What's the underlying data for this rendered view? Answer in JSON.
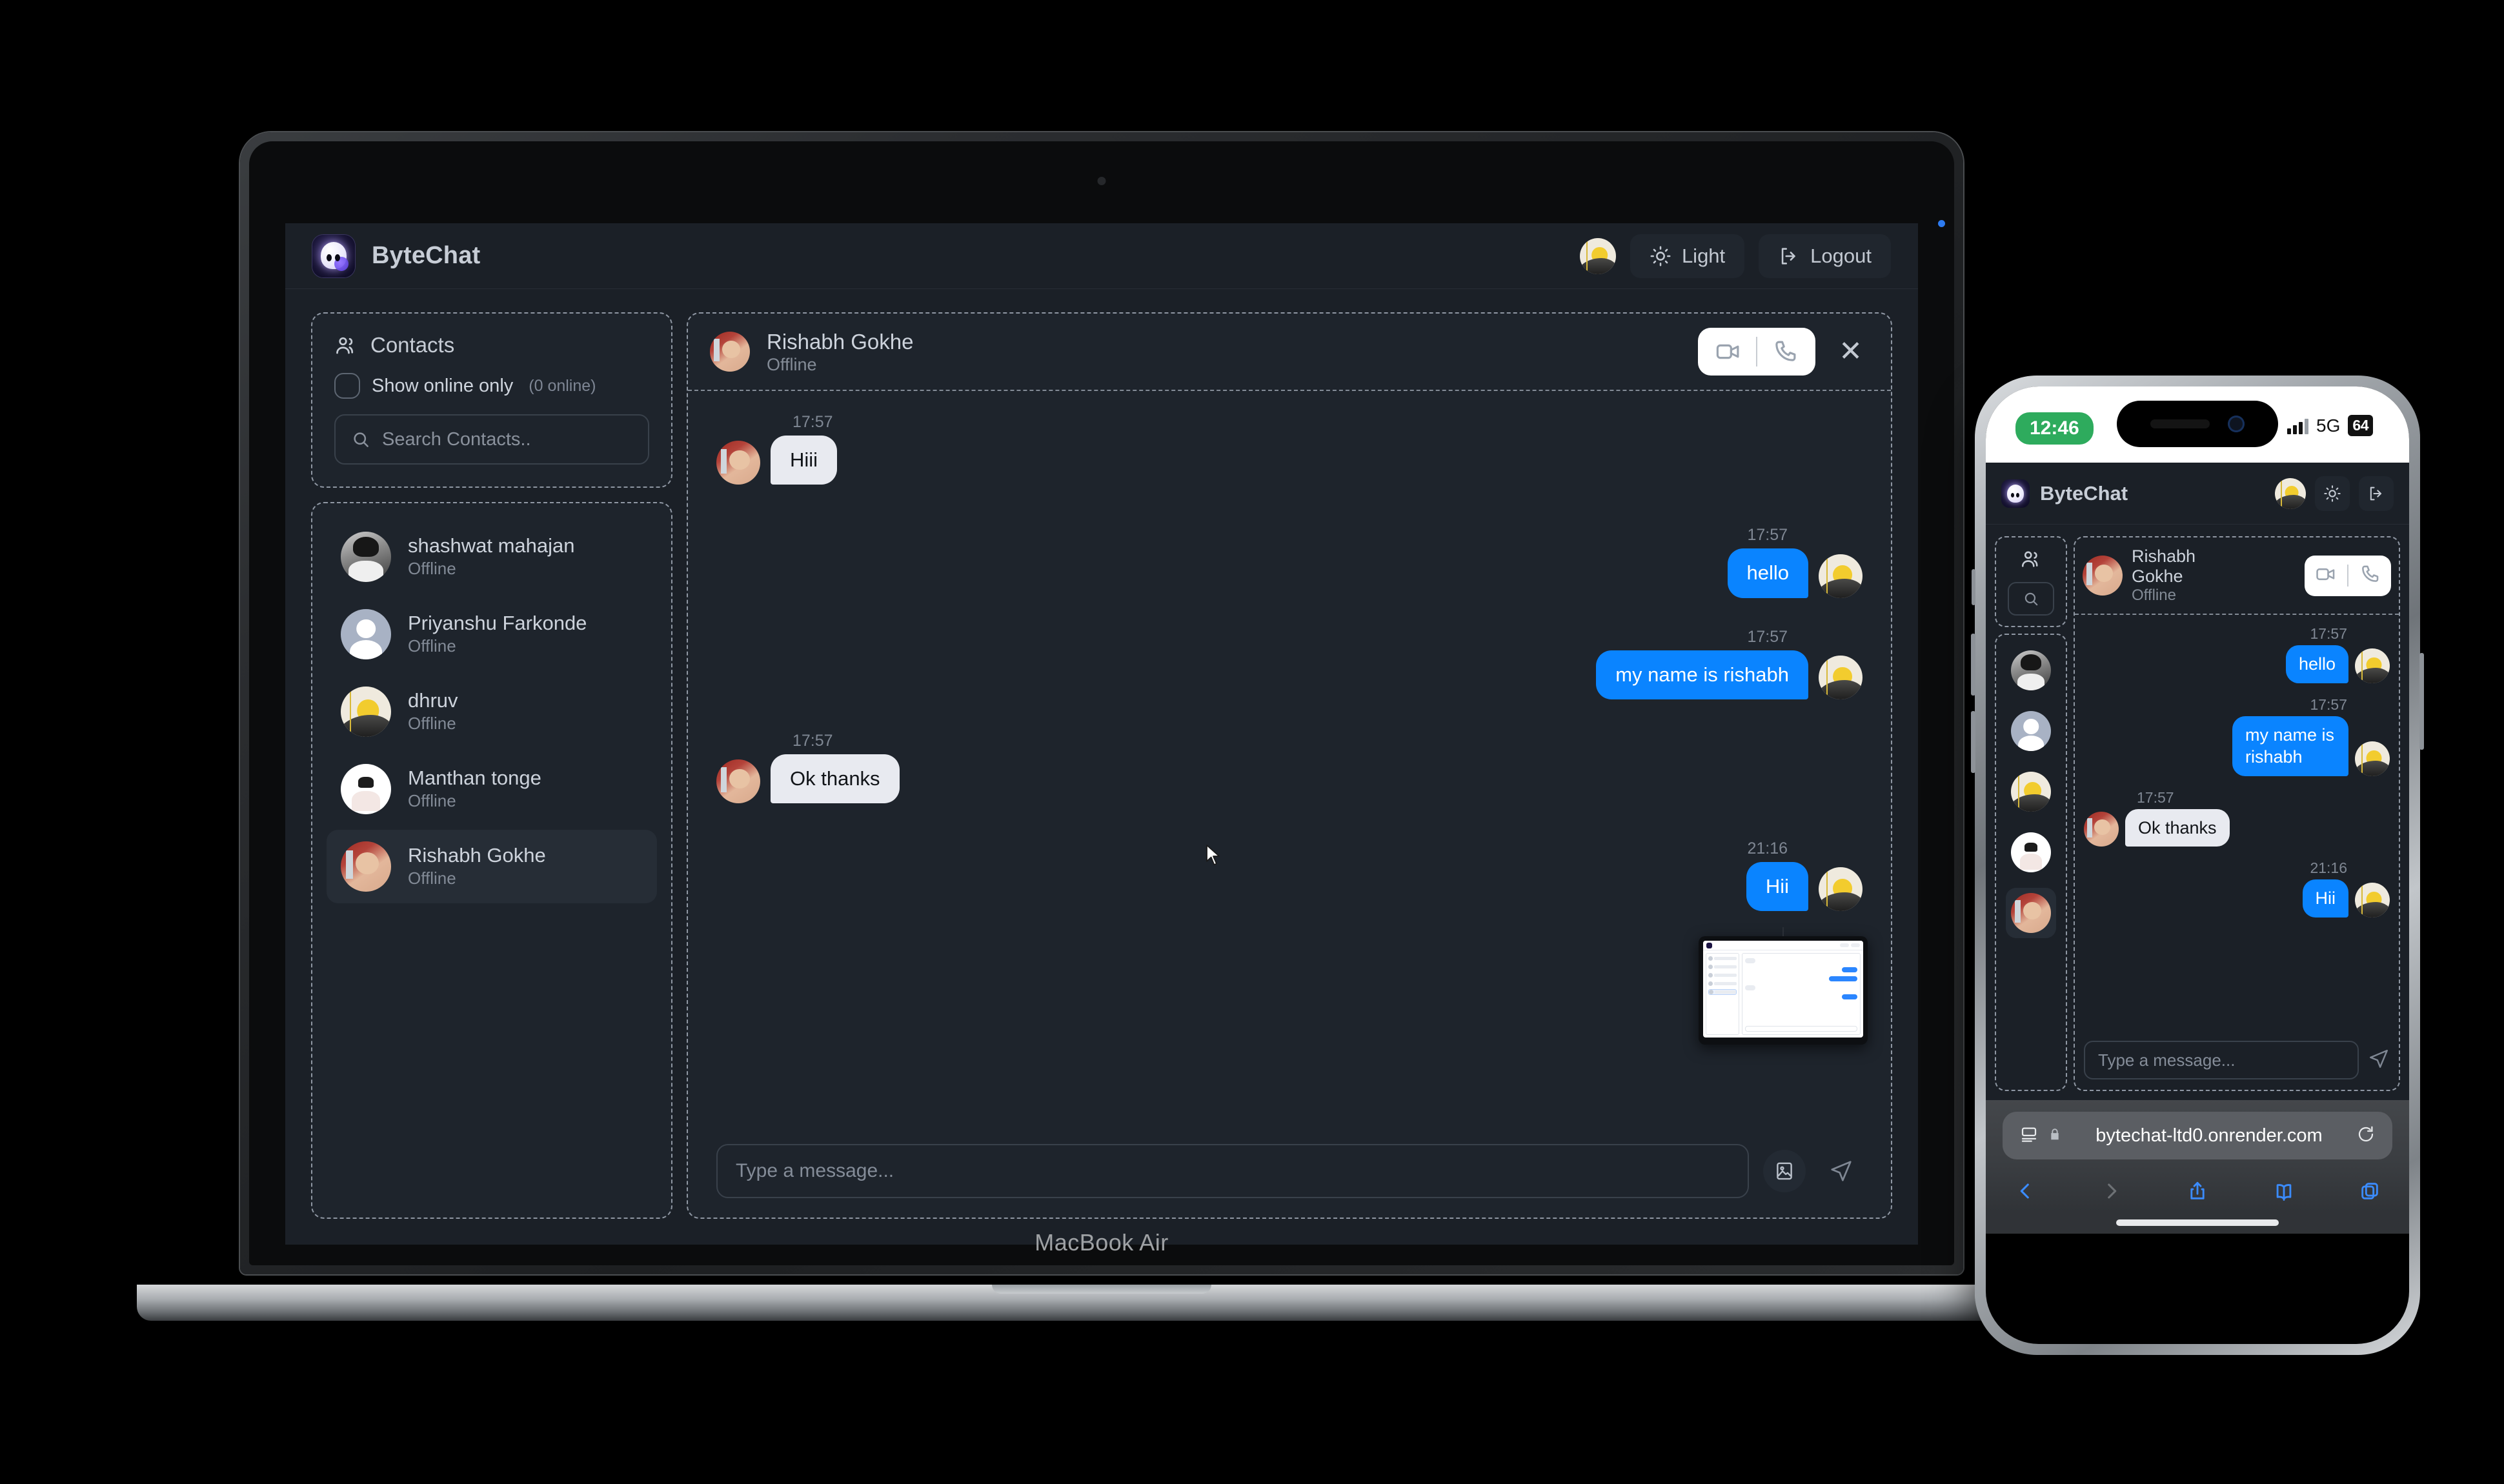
{
  "device": {
    "laptop_label": "MacBook Air"
  },
  "app": {
    "brand": "ByteChat",
    "header": {
      "theme_toggle_label": "Light",
      "logout_label": "Logout",
      "avatar_icon": "sunset-avatar",
      "sun_icon": "sun-icon",
      "logout_icon": "logout-arrow-icon"
    },
    "contacts": {
      "title": "Contacts",
      "title_icon": "people-icon",
      "show_online_label": "Show online only",
      "online_count": "(0 online)",
      "search_placeholder": "Search Contacts..",
      "search_icon": "search-icon",
      "items": [
        {
          "name": "shashwat mahajan",
          "status": "Offline",
          "avatar": "av-shash",
          "selected": false
        },
        {
          "name": "Priyanshu Farkonde",
          "status": "Offline",
          "avatar": "av-person",
          "selected": false
        },
        {
          "name": "dhruv",
          "status": "Offline",
          "avatar": "av-sun",
          "selected": false
        },
        {
          "name": "Manthan tonge",
          "status": "Offline",
          "avatar": "av-babu",
          "selected": false
        },
        {
          "name": "Rishabh Gokhe",
          "status": "Offline",
          "avatar": "av-rishabh",
          "selected": true
        }
      ]
    },
    "chat": {
      "peer_name": "Rishabh Gokhe",
      "peer_status": "Offline",
      "peer_avatar": "av-rishabh",
      "video_call_icon": "video-camera-icon",
      "voice_call_icon": "phone-icon",
      "close_icon": "close-x-icon",
      "messages": [
        {
          "time": "17:57",
          "text": "Hiii",
          "side": "in",
          "avatar": "av-rishabh"
        },
        {
          "time": "17:57",
          "text": "hello",
          "side": "out",
          "avatar": "av-sun"
        },
        {
          "time": "17:57",
          "text": "my name is rishabh",
          "side": "out",
          "avatar": "av-sun"
        },
        {
          "time": "17:57",
          "text": "Ok thanks",
          "side": "in",
          "avatar": "av-rishabh"
        },
        {
          "time": "21:16",
          "text": "Hii",
          "side": "out",
          "avatar": "av-sun"
        }
      ],
      "composer_placeholder": "Type a message...",
      "image_icon": "image-attach-icon",
      "send_icon": "send-paper-plane-icon"
    }
  },
  "phone": {
    "status_bar": {
      "time": "12:46",
      "network": "5G",
      "battery": "64",
      "signal_icon": "signal-bars-icon"
    },
    "app": {
      "brand": "ByteChat",
      "avatar_icon": "sunset-avatar",
      "sun_icon": "sun-icon",
      "logout_icon": "logout-arrow-icon",
      "contacts_icon": "people-icon",
      "search_icon": "search-icon",
      "contacts": [
        {
          "avatar": "av-shash",
          "selected": false
        },
        {
          "avatar": "av-person",
          "selected": false
        },
        {
          "avatar": "av-sun",
          "selected": false
        },
        {
          "avatar": "av-babu",
          "selected": false
        },
        {
          "avatar": "av-rishabh",
          "selected": true
        }
      ],
      "chat": {
        "peer_name_line1": "Rishabh",
        "peer_name_line2": "Gokhe",
        "peer_status": "Offline",
        "peer_avatar": "av-rishabh",
        "video_call_icon": "video-camera-icon",
        "voice_call_icon": "phone-icon",
        "messages": [
          {
            "time": "17:57",
            "text": "hello",
            "side": "out",
            "avatar": "av-sun"
          },
          {
            "time": "17:57",
            "text": "my name is rishabh",
            "side": "out",
            "avatar": "av-sun"
          },
          {
            "time": "17:57",
            "text": "Ok thanks",
            "side": "in",
            "avatar": "av-rishabh"
          },
          {
            "time": "21:16",
            "text": "Hii",
            "side": "out",
            "avatar": "av-sun"
          }
        ],
        "composer_placeholder": "Type a message...",
        "send_icon": "send-paper-plane-icon"
      }
    },
    "browser": {
      "url": "bytechat-ltd0.onrender.com",
      "lock_icon": "lock-icon",
      "reader_icon": "reader-view-icon",
      "reload_icon": "reload-icon",
      "back_icon": "back-chevron-icon",
      "forward_icon": "forward-chevron-icon",
      "share_icon": "share-icon",
      "bookmarks_icon": "book-icon",
      "tabs_icon": "tabs-icon"
    }
  },
  "colors": {
    "accent_blue": "#0a84ff",
    "app_bg": "#1b2027",
    "bubble_in": "#e8eaf0",
    "status_green": "#2eab5d"
  }
}
